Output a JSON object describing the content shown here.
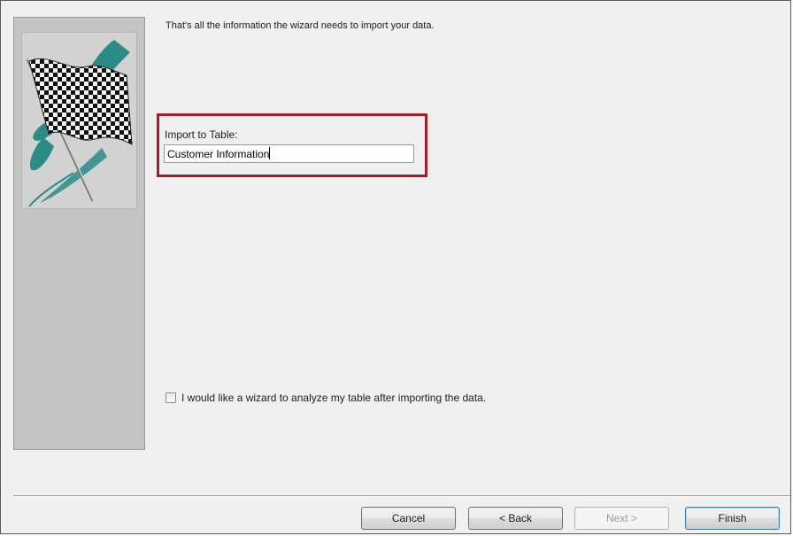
{
  "wizard": {
    "intro_text": "That's all the information the wizard needs to import your data.",
    "import_label": "Import to Table:",
    "table_name_value": "Customer Information",
    "analyze_checkbox_label": "I would like a wizard to analyze my table after importing the data.",
    "analyze_checked": false,
    "highlight_color": "#a51d27",
    "art_icon": "checkered-flag"
  },
  "buttons": {
    "cancel": "Cancel",
    "back": "< Back",
    "next": "Next >",
    "finish": "Finish"
  }
}
